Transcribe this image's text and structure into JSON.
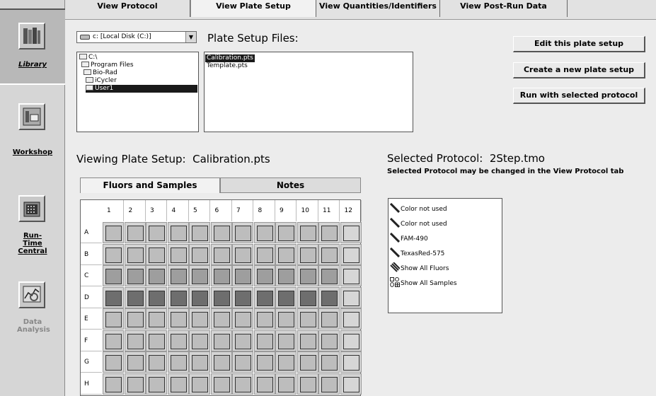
{
  "nav": {
    "items": [
      {
        "label": "Library",
        "icon": "books-icon"
      },
      {
        "label": "Workshop",
        "icon": "workshop-icon"
      },
      {
        "label": "Run-Time Central",
        "icon": "run-time-central-icon"
      },
      {
        "label": "Data Analysis",
        "icon": "data-analysis-icon"
      }
    ]
  },
  "tabs": [
    {
      "label": "View Protocol"
    },
    {
      "label": "View Plate Setup"
    },
    {
      "label": "View Quantities/Identifiers"
    },
    {
      "label": "View Post-Run Data"
    }
  ],
  "drive": {
    "label": "c: [Local Disk (C:)]",
    "arrow": "▼"
  },
  "tree": [
    {
      "label": "C:\\"
    },
    {
      "label": "Program Files"
    },
    {
      "label": "Bio-Rad"
    },
    {
      "label": "iCycler"
    },
    {
      "label": "User1"
    }
  ],
  "files": {
    "title": "Plate Setup Files:",
    "items": [
      {
        "label": "Calibration.pts"
      },
      {
        "label": "Template.pts"
      }
    ]
  },
  "actions": {
    "edit": "Edit this plate setup",
    "create": "Create a new plate setup",
    "run": "Run with selected protocol"
  },
  "viewing": {
    "prefix": "Viewing Plate Setup:",
    "file": "Calibration.pts"
  },
  "protocol": {
    "prefix": "Selected Protocol:",
    "file": "2Step.tmo",
    "note": "Selected Protocol may be changed in the View Protocol tab"
  },
  "subtabs": [
    {
      "label": "Fluors and Samples"
    },
    {
      "label": "Notes"
    }
  ],
  "plate": {
    "columns": [
      "1",
      "2",
      "3",
      "4",
      "5",
      "6",
      "7",
      "8",
      "9",
      "10",
      "11",
      "12"
    ],
    "rows": [
      "A",
      "B",
      "C",
      "D",
      "E",
      "F",
      "G",
      "H"
    ]
  },
  "fluor_list": [
    {
      "label": "Color not used"
    },
    {
      "label": "Color not used"
    },
    {
      "label": "FAM-490"
    },
    {
      "label": "TexasRed-575"
    },
    {
      "label": "Show All Fluors"
    },
    {
      "label": "Show All Samples"
    }
  ]
}
